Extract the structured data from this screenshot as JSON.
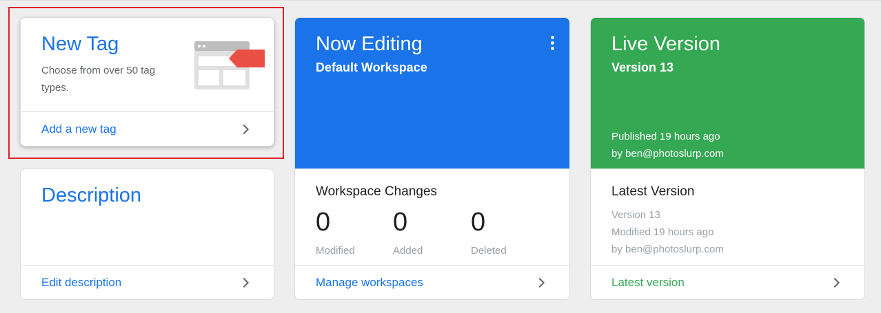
{
  "new_tag": {
    "title": "New Tag",
    "subtitle": "Choose from over 50 tag types.",
    "footer_link": "Add a new tag",
    "icon": "browser-tag-illustration"
  },
  "description": {
    "title": "Description",
    "footer_link": "Edit description"
  },
  "now_editing": {
    "title": "Now Editing",
    "workspace": "Default Workspace",
    "changes_title": "Workspace Changes",
    "stats": [
      {
        "value": "0",
        "label": "Modified"
      },
      {
        "value": "0",
        "label": "Added"
      },
      {
        "value": "0",
        "label": "Deleted"
      }
    ],
    "footer_link": "Manage workspaces",
    "menu_icon": "more-vert-icon",
    "color": "#1a73e8"
  },
  "live_version": {
    "title": "Live Version",
    "version": "Version 13",
    "published": "Published 19 hours ago",
    "published_by": "by ben@photoslurp.com",
    "latest_title": "Latest Version",
    "latest_version": "Version 13",
    "latest_modified": "Modified 19 hours ago",
    "latest_by": "by ben@photoslurp.com",
    "footer_link": "Latest version",
    "color": "#34a853"
  },
  "highlight_color": "#e0222b"
}
